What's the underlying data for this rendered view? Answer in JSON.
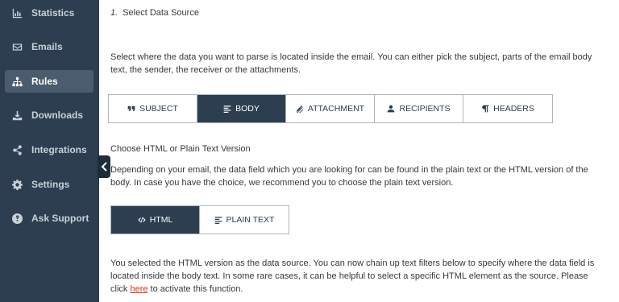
{
  "sidebar": {
    "items": [
      {
        "label": "Statistics",
        "icon": "bar-chart-icon"
      },
      {
        "label": "Emails",
        "icon": "envelope-icon"
      },
      {
        "label": "Rules",
        "icon": "sitemap-icon",
        "active": true
      },
      {
        "label": "Downloads",
        "icon": "download-icon"
      },
      {
        "label": "Integrations",
        "icon": "share-icon"
      },
      {
        "label": "Settings",
        "icon": "gear-icon"
      },
      {
        "label": "Ask Support",
        "icon": "question-circle-icon"
      }
    ]
  },
  "step": {
    "number": "1.",
    "title": "Select Data Source"
  },
  "intro_text": "Select where the data you want to parse is located inside the email. You can either pick the subject, parts of the email body text, the sender, the receiver or the attachments.",
  "source_options": [
    {
      "label": "Subject",
      "icon": "quote-icon"
    },
    {
      "label": "Body",
      "icon": "align-left-icon",
      "active": true
    },
    {
      "label": "Attachment",
      "icon": "paperclip-icon"
    },
    {
      "label": "Recipients",
      "icon": "user-icon"
    },
    {
      "label": "Headers",
      "icon": "paragraph-icon"
    }
  ],
  "version_heading": "Choose HTML or Plain Text Version",
  "version_text": "Depending on your email, the data field which you are looking for can be found in the plain text or the HTML version of the body. In case you have the choice, we recommend you to choose the plain text version.",
  "version_options": [
    {
      "label": "HTML",
      "icon": "code-icon",
      "active": true
    },
    {
      "label": "Plain Text",
      "icon": "align-left-icon"
    }
  ],
  "selection_note": {
    "before": "You selected the HTML version as the data source. You can now chain up text filters below to specify where the data field is located inside the body text. In some rare cases, it can be helpful to select a specific HTML element as the source. Please click ",
    "link": "here",
    "after": " to activate this function."
  },
  "colors": {
    "sidebar_bg": "#2c3e50",
    "active_nav": "#4a5c6d",
    "accent": "#2c3e50",
    "link": "#e0301e"
  }
}
